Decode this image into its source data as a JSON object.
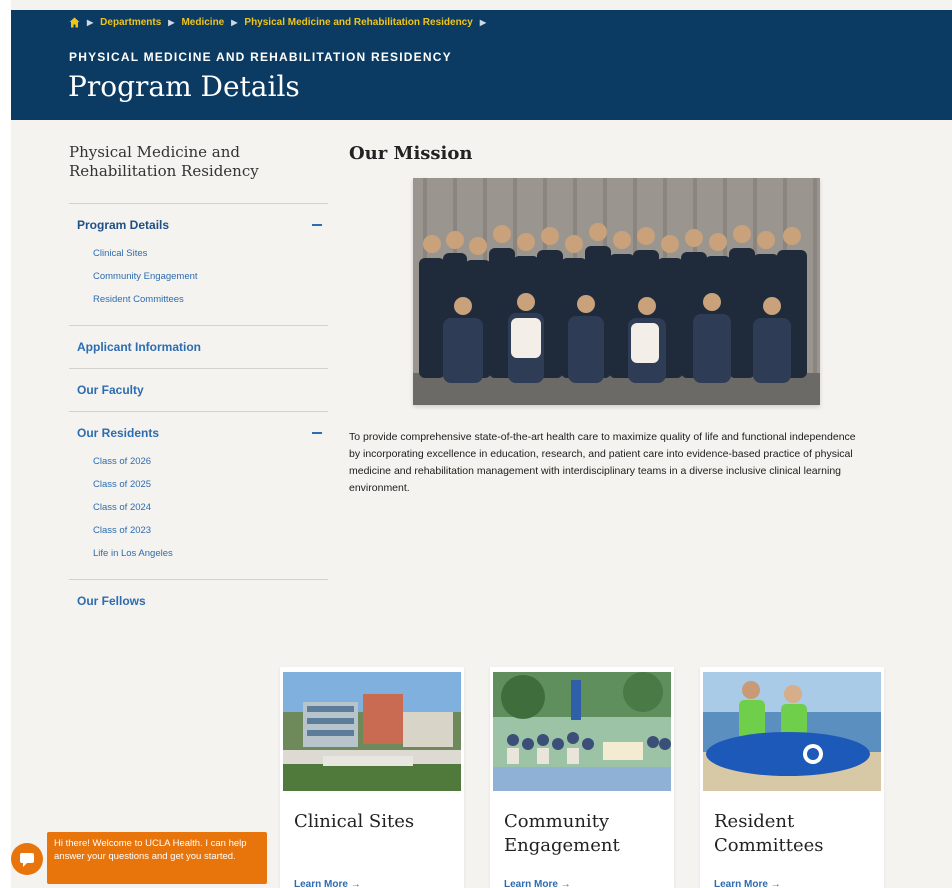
{
  "breadcrumb": {
    "items": [
      "Departments",
      "Medicine",
      "Physical Medicine and Rehabilitation Residency"
    ]
  },
  "hero": {
    "eyebrow": "PHYSICAL MEDICINE AND REHABILITATION RESIDENCY",
    "title": "Program Details"
  },
  "sidebar": {
    "title": "Physical Medicine and Rehabilitation Residency",
    "groups": [
      {
        "label": "Program Details",
        "expanded": true,
        "items": [
          "Clinical Sites",
          "Community Engagement",
          "Resident Committees"
        ]
      },
      {
        "label": "Applicant Information"
      },
      {
        "label": "Our Faculty"
      },
      {
        "label": "Our Residents",
        "expanded": true,
        "items": [
          "Class of 2026",
          "Class of 2025",
          "Class of 2024",
          "Class of 2023",
          "Life in Los Angeles"
        ]
      },
      {
        "label": "Our Fellows"
      }
    ]
  },
  "main": {
    "heading": "Our Mission",
    "text": "To provide comprehensive state-of-the-art health care to maximize quality of life and functional independence by incorporating excellence in education, research, and patient care into evidence-based practice of physical medicine and rehabilitation management with interdisciplinary teams in a diverse inclusive clinical learning environment."
  },
  "cards": [
    {
      "title": "Clinical Sites",
      "link": "Learn More"
    },
    {
      "title": "Community Engagement",
      "link": "Learn More"
    },
    {
      "title": "Resident Committees",
      "link": "Learn More"
    }
  ],
  "chat": {
    "message": "Hi there! Welcome to UCLA Health. I can help answer your questions and get you started."
  },
  "colors": {
    "header_bg": "#0b3b63",
    "breadcrumb": "#f0c419",
    "link": "#2d6cb0",
    "chat": "#e8740c",
    "page_bg": "#f4f3ef"
  },
  "icons": {
    "home": "home-icon",
    "breadcrumb_sep": "chevron-right-icon",
    "collapse": "minus-icon",
    "arrow": "arrow-right-icon",
    "chat": "chat-bubble-icon"
  }
}
